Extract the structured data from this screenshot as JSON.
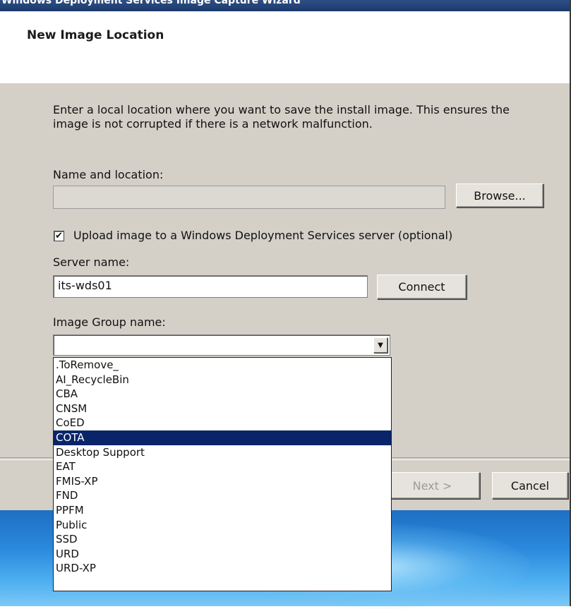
{
  "window": {
    "title": "Windows Deployment Services Image Capture Wizard"
  },
  "header": {
    "title": "New Image Location"
  },
  "form": {
    "description": "Enter a local location where you want to save the install image. This ensures the image is not corrupted if there is a network malfunction.",
    "name_location_label": "Name and location:",
    "name_location_value": "",
    "browse_label": "Browse...",
    "upload_checked": true,
    "upload_check_glyph": "✔",
    "upload_label": "Upload image to a Windows Deployment Services server (optional)",
    "server_name_label": "Server name:",
    "server_name_value": "its-wds01",
    "connect_label": "Connect",
    "image_group_label": "Image Group name:",
    "image_group_value": "",
    "combo_arrow_glyph": "▼"
  },
  "dropdown": {
    "selected": "COTA",
    "options": [
      ".ToRemove_",
      "AI_RecycleBin",
      "CBA",
      "CNSM",
      "CoED",
      "COTA",
      "Desktop Support",
      "EAT",
      "FMIS-XP",
      "FND",
      "PPFM",
      "Public",
      "SSD",
      "URD",
      "URD-XP"
    ]
  },
  "footer": {
    "next_label": "Next >",
    "cancel_label": "Cancel"
  },
  "colors": {
    "dialog_bg": "#d4d0c8",
    "selection": "#0a246a",
    "desktop_blue": "#2a89dd"
  }
}
